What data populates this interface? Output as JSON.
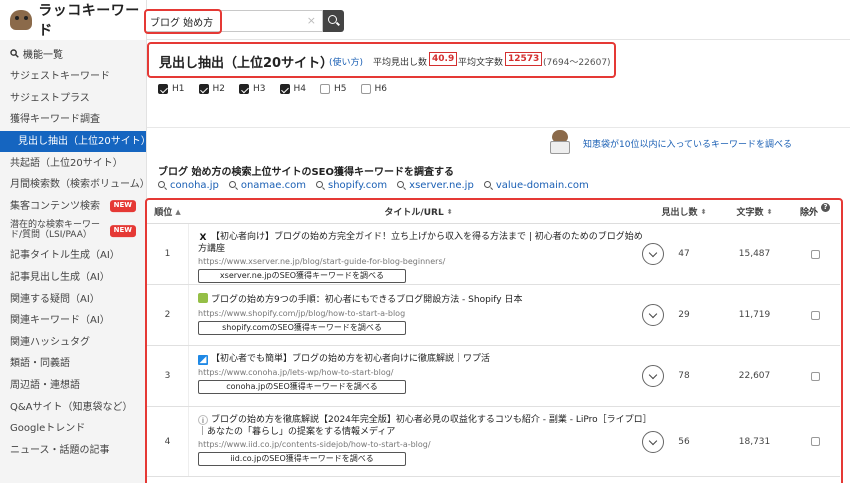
{
  "app": {
    "name": "ラッコキーワード"
  },
  "search": {
    "value": "ブログ 始め方",
    "clear": "×"
  },
  "sidebar": {
    "section_label": "機能一覧",
    "items": [
      {
        "label": "サジェストキーワード"
      },
      {
        "label": "サジェストプラス"
      },
      {
        "label": "獲得キーワード調査"
      },
      {
        "label": "見出し抽出（上位20サイト）",
        "active": true
      },
      {
        "label": "共起語（上位20サイト）"
      },
      {
        "label": "月間検索数（検索ボリューム）"
      },
      {
        "label": "集客コンテンツ検索",
        "badge": "NEW"
      },
      {
        "label": "潜在的な検索キーワード/質問（LSI/PAA）",
        "badge": "NEW"
      },
      {
        "label": "記事タイトル生成（AI）"
      },
      {
        "label": "記事見出し生成（AI）"
      },
      {
        "label": "関連する疑問（AI）"
      },
      {
        "label": "関連キーワード（AI）"
      },
      {
        "label": "関連ハッシュタグ"
      },
      {
        "label": "類語・同義語"
      },
      {
        "label": "周辺語・連想語"
      },
      {
        "label": "Q&Aサイト（知恵袋など）"
      },
      {
        "label": "Googleトレンド"
      },
      {
        "label": "ニュース・話題の記事"
      }
    ]
  },
  "header": {
    "title": "見出し抽出（上位20サイト）",
    "usage_link": "(使い方)",
    "avg_headings_label": "平均見出し数",
    "avg_headings_value": "40.9",
    "avg_chars_label": "平均文字数",
    "avg_chars_value": "12573",
    "char_range": "(7694〜22607)"
  },
  "filters": [
    {
      "label": "H1",
      "checked": true
    },
    {
      "label": "H2",
      "checked": true
    },
    {
      "label": "H3",
      "checked": true
    },
    {
      "label": "H4",
      "checked": true
    },
    {
      "label": "H5",
      "checked": false
    },
    {
      "label": "H6",
      "checked": false
    }
  ],
  "promo": {
    "link_text": "知恵袋が10位以内に入っているキーワードを調べる"
  },
  "competitor_section": {
    "title": "ブログ 始め方の検索上位サイトのSEO獲得キーワードを調査する",
    "domains": [
      "conoha.jp",
      "onamae.com",
      "shopify.com",
      "xserver.ne.jp",
      "value-domain.com"
    ]
  },
  "table": {
    "columns": {
      "rank": "順位",
      "title": "タイトル/URL",
      "headings": "見出し数",
      "chars": "文字数",
      "exclude": "除外"
    },
    "sort_asc": "▲",
    "sort_both": "⬍",
    "rows": [
      {
        "rank": "1",
        "icon": "X",
        "icon_color": "#111111",
        "title": "【初心者向け】ブログの始め方完全ガイド！立ち上げから収入を得る方法まで | 初心者のためのブログ始め方講座",
        "url": "https://www.xserver.ne.jp/blog/start-guide-for-blog-beginners/",
        "button": "xserver.ne.jpのSEO獲得キーワードを調べる",
        "headings": "47",
        "chars": "15,487"
      },
      {
        "rank": "2",
        "icon": "S",
        "icon_color": "#95bf47",
        "title": "ブログの始め方9つの手順：初心者にもできるブログ開設方法 - Shopify 日本",
        "url": "https://www.shopify.com/jp/blog/how-to-start-a-blog",
        "button": "shopify.comのSEO獲得キーワードを調べる",
        "headings": "29",
        "chars": "11,719"
      },
      {
        "rank": "3",
        "icon": "Z",
        "icon_color": "#1e88e5",
        "title": "【初心者でも簡単】ブログの始め方を初心者向けに徹底解説｜ワプ活",
        "url": "https://www.conoha.jp/lets-wp/how-to-start-blog/",
        "button": "conoha.jpのSEO獲得キーワードを調べる",
        "headings": "78",
        "chars": "22,607"
      },
      {
        "rank": "4",
        "icon": "i",
        "icon_color": "#999999",
        "title": "ブログの始め方を徹底解説【2024年完全版】初心者必見の収益化するコツも紹介 - 副業 - LiPro［ライプロ］｜あなたの「暮らし」の提案をする情報メディア",
        "url": "https://www.iid.co.jp/contents-sidejob/how-to-start-a-blog/",
        "button": "iid.co.jpのSEO獲得キーワードを調べる",
        "headings": "56",
        "chars": "18,731"
      }
    ]
  }
}
